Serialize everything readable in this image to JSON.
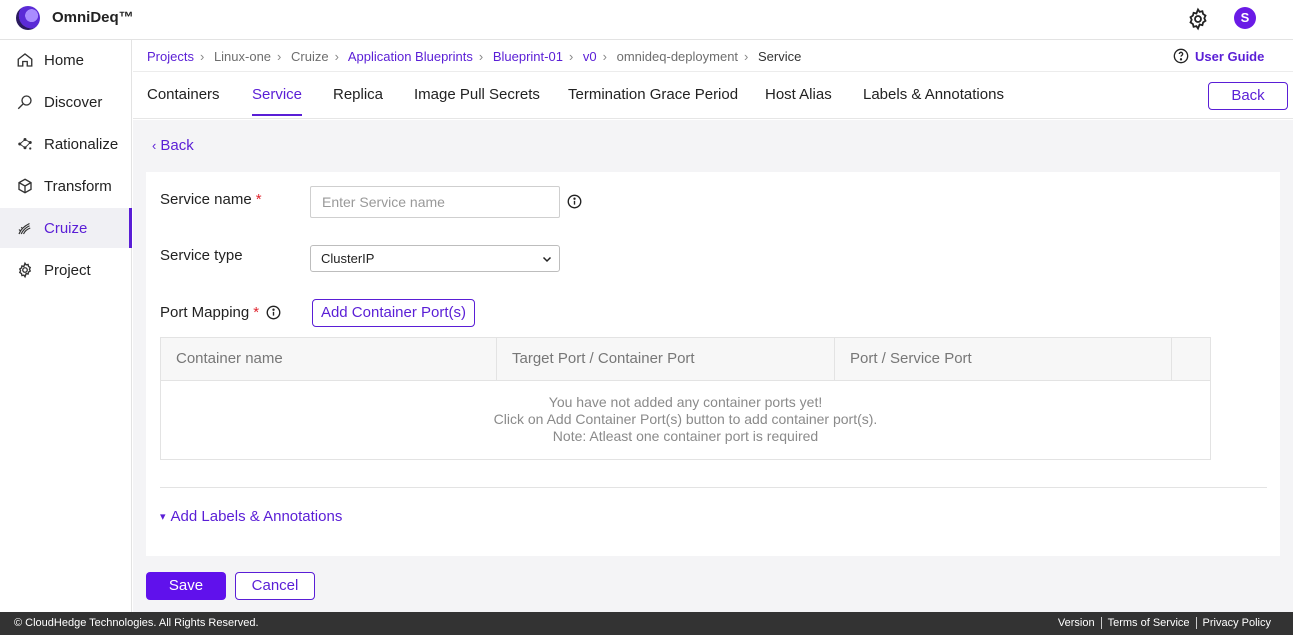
{
  "app": {
    "brand": "OmniDeq™",
    "avatar_letter": "S",
    "accent": "#5a1ed6"
  },
  "sidebar": {
    "items": [
      {
        "label": "Home",
        "icon": "home-icon"
      },
      {
        "label": "Discover",
        "icon": "discover-icon"
      },
      {
        "label": "Rationalize",
        "icon": "rationalize-icon"
      },
      {
        "label": "Transform",
        "icon": "transform-icon"
      },
      {
        "label": "Cruize",
        "icon": "cruize-icon",
        "active": true
      },
      {
        "label": "Project",
        "icon": "project-icon"
      }
    ]
  },
  "breadcrumb": {
    "items": [
      "Projects",
      "Linux-one",
      "Cruize",
      "Application Blueprints",
      "Blueprint-01",
      "v0",
      "omnideq-deployment",
      "Service"
    ],
    "user_guide": "User Guide"
  },
  "tabs": {
    "items": [
      "Containers",
      "Service",
      "Replica",
      "Image Pull Secrets",
      "Termination Grace Period",
      "Host Alias",
      "Labels & Annotations"
    ],
    "active": "Service",
    "back_button": "Back"
  },
  "form": {
    "back_link": "Back",
    "service_name_label": "Service name",
    "service_name_placeholder": "Enter  Service name",
    "service_name_value": "",
    "service_type_label": "Service type",
    "service_type_value": "ClusterIP",
    "port_mapping_label": "Port Mapping",
    "add_port_button": "Add Container Port(s)",
    "required_mark": "*",
    "table": {
      "columns": [
        "Container name",
        "Target Port / Container Port",
        "Port / Service Port",
        ""
      ],
      "empty_lines": [
        "You have not added any container ports yet!",
        "Click on Add Container Port(s) button to add container port(s).",
        "Note: Atleast one container port is required"
      ]
    },
    "add_labels_link": "Add Labels & Annotations"
  },
  "actions": {
    "save": "Save",
    "cancel": "Cancel"
  },
  "footer": {
    "copyright": "© CloudHedge Technologies. All Rights Reserved.",
    "links": [
      "Version",
      "Terms of Service",
      "Privacy Policy"
    ]
  }
}
